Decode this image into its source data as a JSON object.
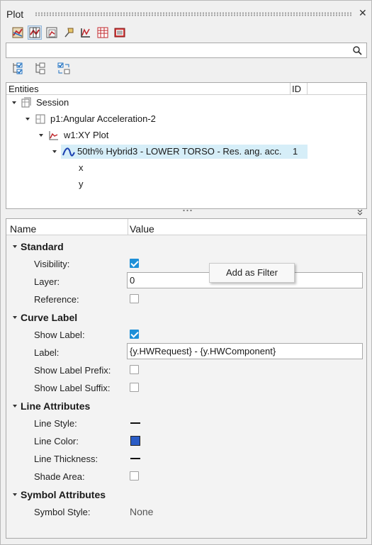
{
  "window": {
    "title": "Plot",
    "close_glyph": "✕"
  },
  "toolbar": {
    "icons": [
      "curve-edit-icon",
      "plot-layout-icon",
      "page-icon",
      "pin-icon",
      "axis-icon",
      "table-icon",
      "legend-icon"
    ]
  },
  "search": {
    "value": "",
    "placeholder": ""
  },
  "entities": {
    "header_name": "Entities",
    "header_id": "ID",
    "session": "Session",
    "page": "p1:Angular Acceleration-2",
    "window": "w1:XY Plot",
    "curve": "50th% Hybrid3   - LOWER TORSO - Res. ang. acc.",
    "curve_id": "1",
    "x": "x",
    "y": "y"
  },
  "properties": {
    "header_name": "Name",
    "header_value": "Value",
    "standard": {
      "title": "Standard",
      "visibility_label": "Visibility:",
      "visibility": true,
      "layer_label": "Layer:",
      "layer_value": "0",
      "reference_label": "Reference:",
      "reference": false
    },
    "curve_label": {
      "title": "Curve Label",
      "show_label_label": "Show Label:",
      "show_label": true,
      "label_label": "Label:",
      "label_value": "{y.HWRequest} - {y.HWComponent}",
      "prefix_label": "Show Label Prefix:",
      "prefix": false,
      "suffix_label": "Show Label Suffix:",
      "suffix": false
    },
    "line_attributes": {
      "title": "Line Attributes",
      "style_label": "Line Style:",
      "color_label": "Line Color:",
      "color": "#2a5cc6",
      "thickness_label": "Line Thickness:",
      "shade_label": "Shade Area:",
      "shade": false
    },
    "symbol_attributes": {
      "title": "Symbol Attributes",
      "style_label": "Symbol Style:",
      "style_value": "None"
    }
  },
  "context_menu": {
    "item": "Add as Filter"
  }
}
